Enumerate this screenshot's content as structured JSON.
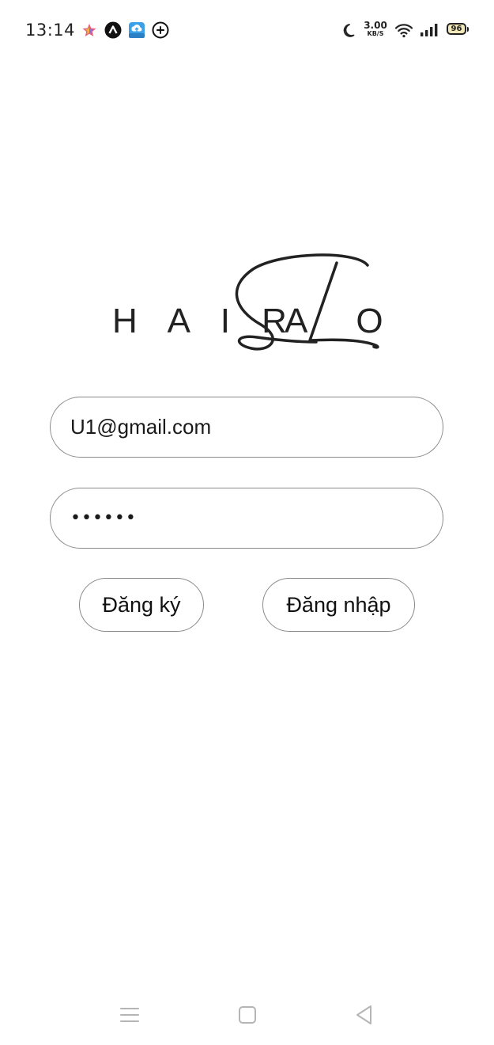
{
  "status_bar": {
    "time": "13:14",
    "notification_icons": [
      "star-app-icon",
      "a-app-icon",
      "cloud-upload-app-icon",
      "plus-circle-icon"
    ],
    "net_speed_value": "3.00",
    "net_speed_unit": "KB/S",
    "system_icons": [
      "moon-icon",
      "wifi-icon",
      "signal-icon",
      "battery-icon"
    ],
    "battery_level": "96"
  },
  "logo": {
    "text": "HAIRSALON",
    "left_text": "H A I R",
    "right_text": "A  O N"
  },
  "login_form": {
    "email_value": "U1@gmail.com",
    "password_value": "••••••"
  },
  "buttons": {
    "register_label": "Đăng ký",
    "login_label": "Đăng nhập"
  },
  "nav_bar": {
    "icons": [
      "menu-icon",
      "home-icon",
      "back-icon"
    ]
  }
}
